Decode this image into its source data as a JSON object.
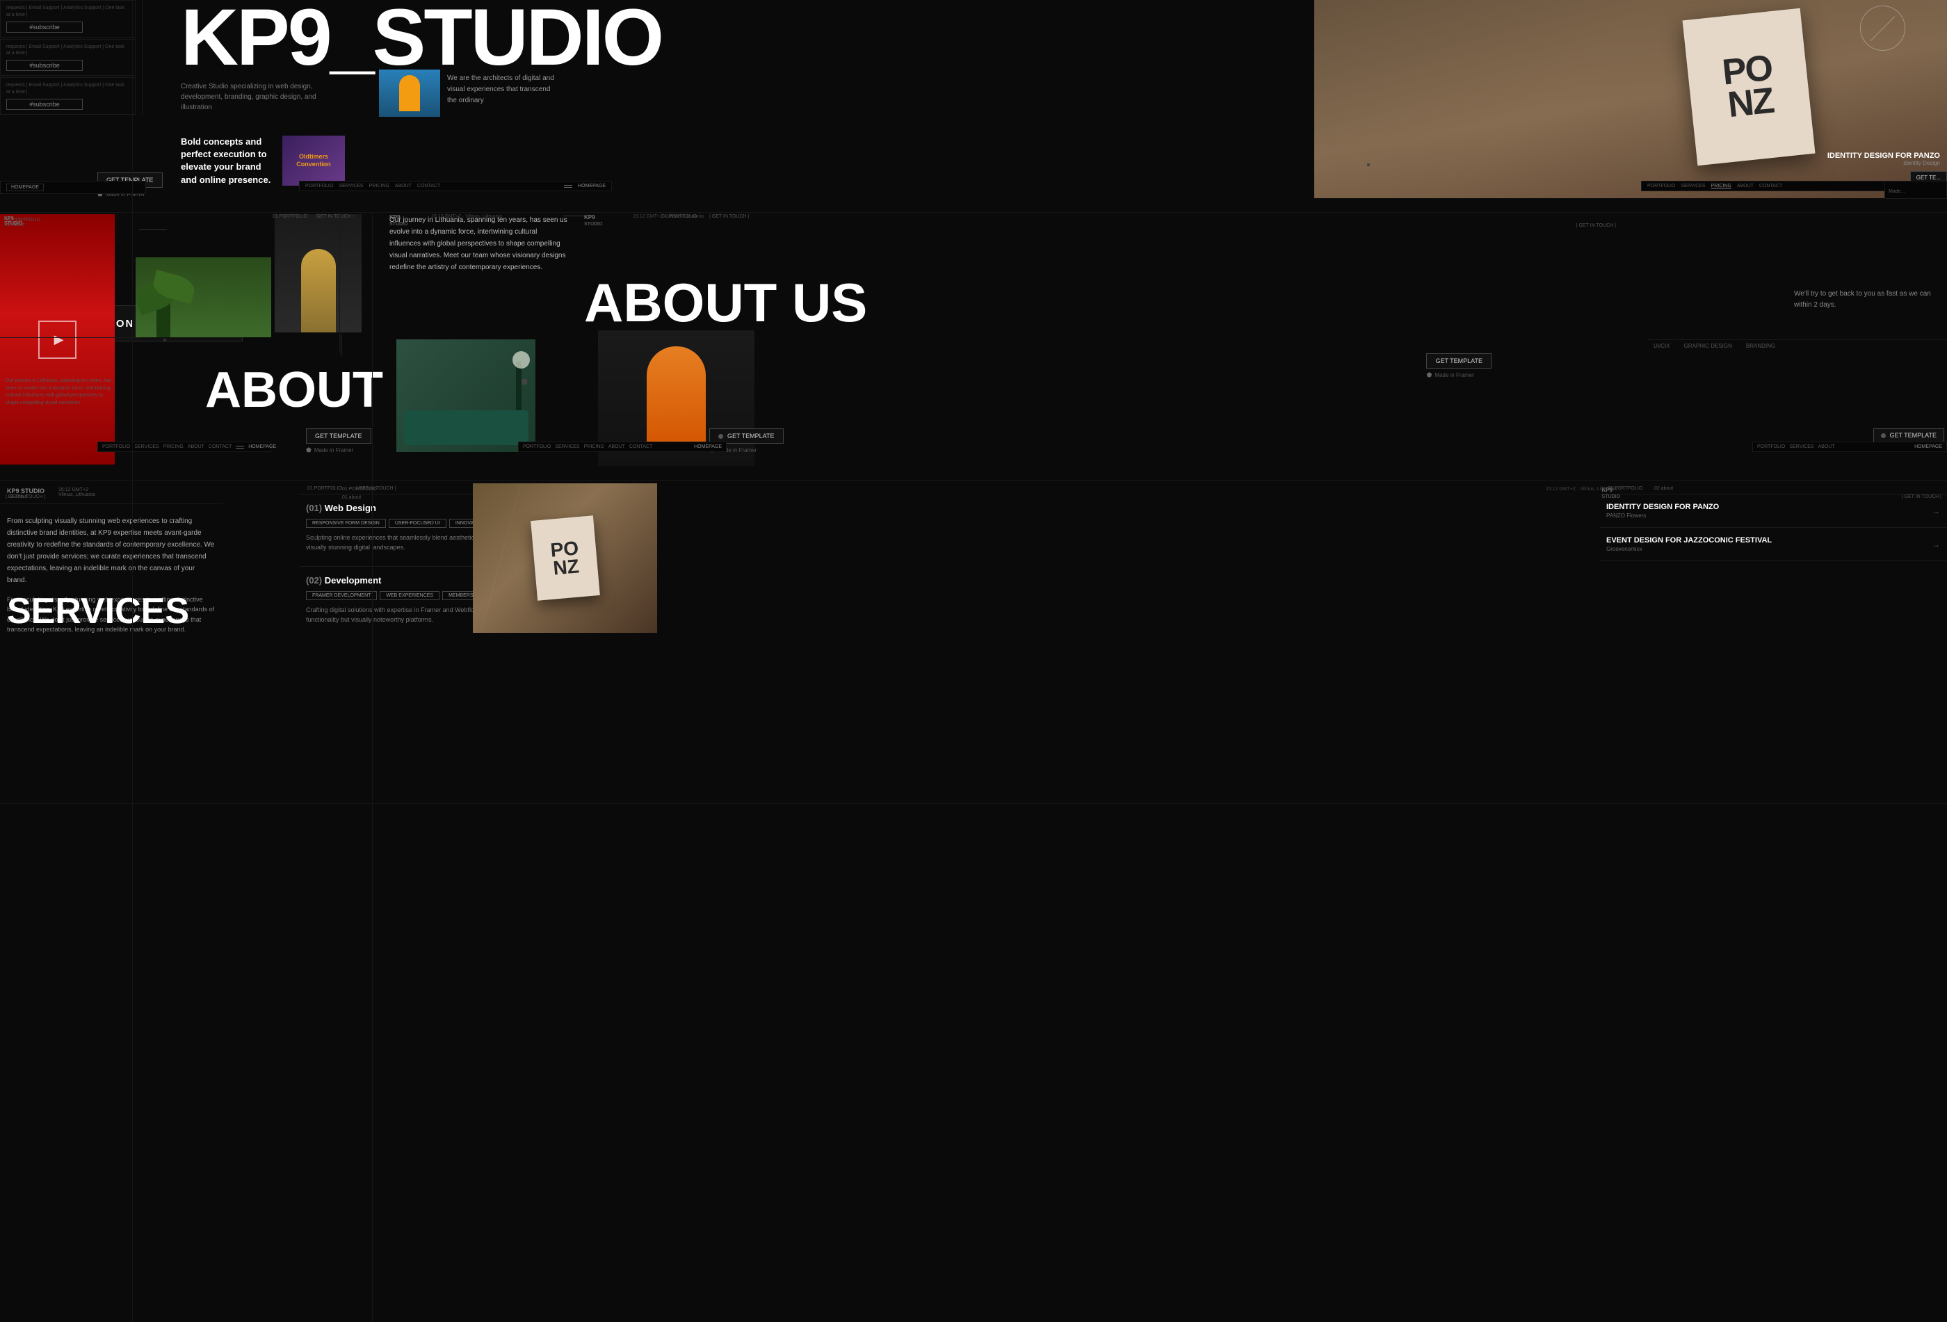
{
  "site": {
    "title": "KP9_STUDIO",
    "tagline": "Creative Studio specializing in web design, development, branding, graphic design, and illustration",
    "architects_quote": "We are the architects of digital and visual experiences that transcend the ordinary"
  },
  "subscribe": {
    "items": [
      {
        "label": "requests | Email Support | Analytics Support | One task at a time |",
        "button": "#subscribe"
      },
      {
        "label": "requests | Email Support | Analytics Support | One task at a time |",
        "button": "#subscribe"
      },
      {
        "label": "requests | Email Support | Analytics Support | One task at a time |",
        "button": "#subscribe"
      }
    ]
  },
  "custom_solution": {
    "text": "CUSTOM SOLUTION",
    "arrow": "→"
  },
  "buttons": {
    "get_template_1": "GET TEMPLATE",
    "get_template_2": "GET TEMPLATE",
    "get_template_3": "GET TEMPLATE",
    "get_template_4": "GET TEMPLATE",
    "made_in_framer": "Made in Framer"
  },
  "nav": {
    "items": [
      "PORTFOLIO",
      "SERVICES",
      "PRICING",
      "ABOUT",
      "CONTACT"
    ],
    "home": "HOMEPAGE"
  },
  "sections": {
    "about_us": {
      "heading": "ABOUT US",
      "journey_text": "Our journey in Lithuania, spanning ten years, has seen us evolve into a dynamic force, intertwining cultural influences with global perspectives to shape compelling visual narratives. Meet our team whose visionary designs redefine the artistry of contemporary experiences.",
      "short_text": "Our journey in Lithuania, spanning ten years, has seen us evolve into a dynamic force, intertwining cultural influences with global perspectives to shape compelling visual narratives."
    },
    "services": {
      "heading": "SERVICES",
      "intro": "From sculpting visually stunning web experiences to crafting distinctive brand identities, at KP9 expertise meets avant-garde creativity to redefine the standards of contemporary excellence. We don't just provide services; we curate experiences that transcend expectations, leaving an indelible mark on the canvas of your brand.",
      "items": [
        {
          "number": "(01)",
          "title": "Web Design",
          "tags": [
            "RESPONSIVE FORM DESIGN",
            "USER-FOCUSED UI",
            "INNOVATIVE INTERACTIONS"
          ],
          "desc": "Sculpting online experiences that seamlessly blend aesthetics with functionality, creating visually stunning digital landscapes."
        },
        {
          "number": "(02)",
          "title": "Development",
          "tags": [
            "FRAMER DEVELOPMENT",
            "WEB EXPERIENCES",
            "MEMBERSHIP AND E-COMMERCE"
          ],
          "desc": "Crafting digital solutions with expertise in Framer and Webflow, ensuring not just functionality but visually noteworthy platforms."
        }
      ]
    },
    "contact": {
      "reply_text": "We'll try to get back to you as fast as we can within 2 days."
    }
  },
  "portfolio": {
    "number": ".01 PORTFOLIO",
    "about": ".02 about",
    "identity_design": {
      "title": "IDENTITY DESIGN FOR PANZO",
      "subtitle": "Identity Design",
      "sub2": "PANZO Flowers"
    },
    "event_design": {
      "title": "EVENT DESIGN FOR JAZZOCONIC FESTIVAL",
      "subtitle": "Groovenomicx"
    }
  },
  "meta": {
    "time": "15:12 GMT+2",
    "location": "Vilnius, Lithuania",
    "studio": "KP9 STUDIO"
  },
  "colors": {
    "background": "#080808",
    "surface": "#0d0d0d",
    "border": "#1f1f1f",
    "text_primary": "#ffffff",
    "text_secondary": "#888888",
    "text_dim": "#555555",
    "accent_orange": "#e67e22",
    "accent_red": "#cc0000"
  }
}
